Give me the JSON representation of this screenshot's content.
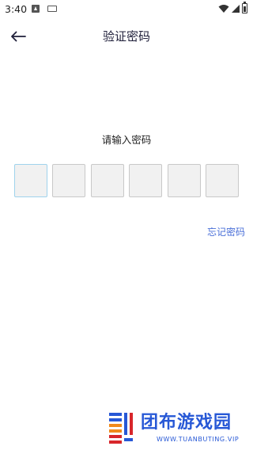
{
  "status_bar": {
    "time": "3:40",
    "icons": [
      "notification-a-icon",
      "keyboard-icon",
      "wifi-icon",
      "cellular-icon",
      "battery-icon"
    ]
  },
  "header": {
    "title": "验证密码",
    "back_icon": "back-arrow-icon"
  },
  "prompt": "请输入密码",
  "password": {
    "length": 6,
    "filled": 0,
    "active_index": 0
  },
  "forgot_link": "忘记密码",
  "watermark": {
    "name": "团布游戏园",
    "sub": "WWW.TUANBUTING.VIP",
    "colors": {
      "blue": "#2758d6",
      "orange": "#f08a1c",
      "red": "#d8262b"
    }
  },
  "colors": {
    "title": "#1f1f3a",
    "link": "#4a6fd8",
    "box_fill": "#f1f1f1",
    "box_border": "#c8c8c8",
    "box_active_border": "#9fd3ec"
  }
}
